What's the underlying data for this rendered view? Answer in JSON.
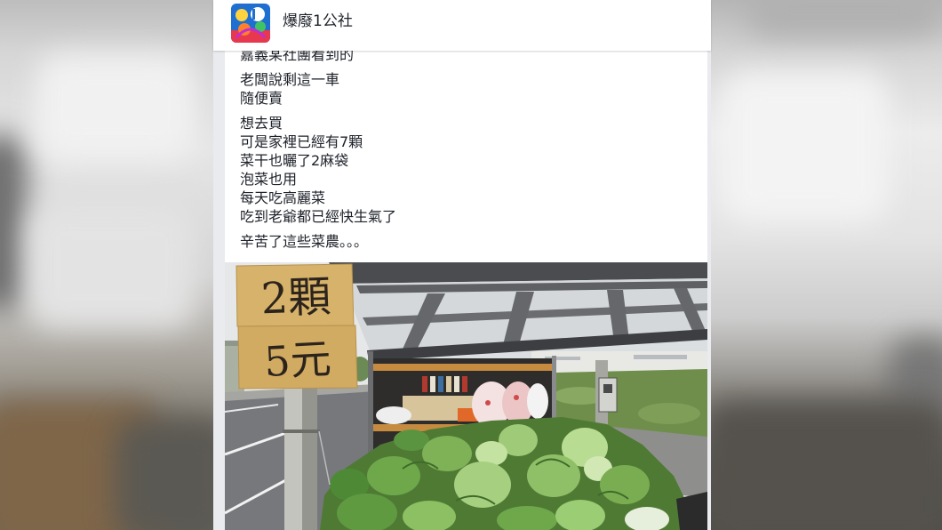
{
  "page": {
    "name": "爆廢1公社"
  },
  "post": {
    "paragraphs": [
      [
        "嘉義某社團看到的"
      ],
      [
        "老闆說剩這一車",
        "隨便賣"
      ],
      [
        "想去買",
        "可是家裡已經有7顆",
        "菜干也曬了2麻袋",
        "泡菜也用",
        "每天吃高麗菜",
        "吃到老爺都已經快生氣了"
      ],
      [
        "辛苦了這些菜農。。。"
      ]
    ]
  },
  "photo": {
    "sign": [
      "2顆",
      "5元"
    ]
  },
  "colors": {
    "feed_background": "#e9ebee",
    "card_background": "#ffffff",
    "text": "#1d2129",
    "sign_cardboard": "#d6b26a",
    "cabbage_green": "#8fc068"
  }
}
